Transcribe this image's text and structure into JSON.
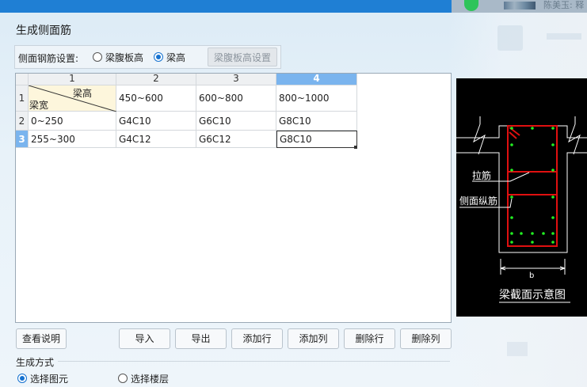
{
  "window": {
    "title": "生成侧面筋"
  },
  "taskbar": {
    "user_text": "陈美玉: 释"
  },
  "setting": {
    "label": "侧面钢筋设置:",
    "options": [
      {
        "label": "梁腹板高",
        "selected": false
      },
      {
        "label": "梁高",
        "selected": true
      }
    ],
    "button_label": "梁腹板高设置"
  },
  "grid": {
    "column_headers": [
      "1",
      "2",
      "3",
      "4"
    ],
    "selected_column": "4",
    "corner": {
      "top_label": "梁高",
      "bottom_label": "梁宽"
    },
    "rows": [
      {
        "index": "1",
        "cells": [
          "450~600",
          "600~800",
          "800~1000"
        ]
      },
      {
        "index": "2",
        "cells": [
          "0~250",
          "G4C10",
          "G6C10",
          "G8C10"
        ]
      },
      {
        "index": "3",
        "cells": [
          "255~300",
          "G4C12",
          "G6C12",
          "G8C10"
        ]
      }
    ],
    "selected_row": "3"
  },
  "diagram": {
    "label_tie": "拉筋",
    "label_side": "侧面纵筋",
    "label_b": "b",
    "caption": "梁截面示意图",
    "colors": {
      "stirrup": "#e01010",
      "bar": "#22ee22",
      "line": "#ffffff"
    }
  },
  "buttons": {
    "help": "查看说明",
    "import": "导入",
    "export": "导出",
    "add_row": "添加行",
    "add_col": "添加列",
    "del_row": "删除行",
    "del_col": "删除列"
  },
  "generation": {
    "label": "生成方式",
    "options": [
      {
        "label": "选择图元",
        "selected": true
      },
      {
        "label": "选择楼层",
        "selected": false
      }
    ]
  }
}
